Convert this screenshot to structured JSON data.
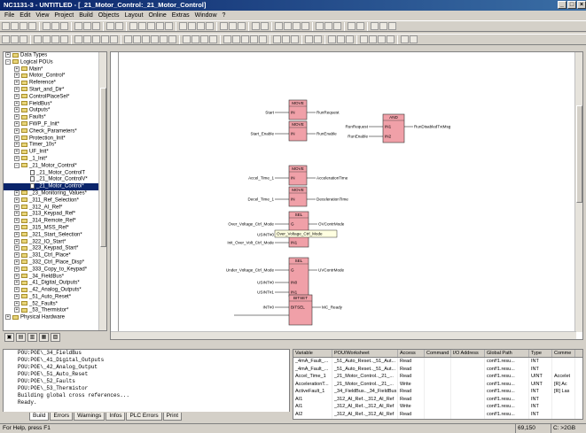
{
  "window": {
    "title": "NC1131-3 - UNTITLED - [_21_Motor_Control:_21_Motor_Control]"
  },
  "menu": [
    "File",
    "Edit",
    "View",
    "Project",
    "Build",
    "Objects",
    "Layout",
    "Online",
    "Extras",
    "Window",
    "?"
  ],
  "tree": [
    {
      "label": "Data Types",
      "level": 1,
      "kind": "folder",
      "toggle": "+"
    },
    {
      "label": "Logical POUs",
      "level": 1,
      "kind": "folder",
      "toggle": "−"
    },
    {
      "label": "Main*",
      "level": 2,
      "kind": "folder",
      "toggle": "+"
    },
    {
      "label": "Motor_Control*",
      "level": 2,
      "kind": "folder",
      "toggle": "+"
    },
    {
      "label": "Reference*",
      "level": 2,
      "kind": "folder",
      "toggle": "+"
    },
    {
      "label": "Start_and_Dir*",
      "level": 2,
      "kind": "folder",
      "toggle": "+"
    },
    {
      "label": "ControlPlaceSel*",
      "level": 2,
      "kind": "folder",
      "toggle": "+"
    },
    {
      "label": "FieldBus*",
      "level": 2,
      "kind": "folder",
      "toggle": "+"
    },
    {
      "label": "Outputs*",
      "level": 2,
      "kind": "folder",
      "toggle": "+"
    },
    {
      "label": "Faults*",
      "level": 2,
      "kind": "folder",
      "toggle": "+"
    },
    {
      "label": "FWP_F_Init*",
      "level": 2,
      "kind": "folder",
      "toggle": "+"
    },
    {
      "label": "Check_Parameters*",
      "level": 2,
      "kind": "folder",
      "toggle": "+"
    },
    {
      "label": "Protection_Init*",
      "level": 2,
      "kind": "folder",
      "toggle": "+"
    },
    {
      "label": "Timer_10s*",
      "level": 2,
      "kind": "folder",
      "toggle": "+"
    },
    {
      "label": "UF_Init*",
      "level": 2,
      "kind": "folder",
      "toggle": "+"
    },
    {
      "label": "_1_Init*",
      "level": 2,
      "kind": "folder",
      "toggle": "+"
    },
    {
      "label": "_21_Motor_Control*",
      "level": 2,
      "kind": "folder",
      "toggle": "−"
    },
    {
      "label": "_21_Motor_ControlT",
      "level": 3,
      "kind": "page",
      "toggle": ""
    },
    {
      "label": "_21_Motor_ControlV*",
      "level": 3,
      "kind": "page",
      "toggle": ""
    },
    {
      "label": "_21_Motor_Control*",
      "level": 3,
      "kind": "page",
      "toggle": ""
    },
    {
      "label": "_23_Monitoring_Values*",
      "level": 2,
      "kind": "folder",
      "toggle": "+"
    },
    {
      "label": "_311_Ref_Selection*",
      "level": 2,
      "kind": "folder",
      "toggle": "+"
    },
    {
      "label": "_312_AI_Ref*",
      "level": 2,
      "kind": "folder",
      "toggle": "+"
    },
    {
      "label": "_313_Keypad_Ref*",
      "level": 2,
      "kind": "folder",
      "toggle": "+"
    },
    {
      "label": "_314_Remote_Ref*",
      "level": 2,
      "kind": "folder",
      "toggle": "+"
    },
    {
      "label": "_315_MSS_Ref*",
      "level": 2,
      "kind": "folder",
      "toggle": "+"
    },
    {
      "label": "_321_Start_Selection*",
      "level": 2,
      "kind": "folder",
      "toggle": "+"
    },
    {
      "label": "_322_IO_Start*",
      "level": 2,
      "kind": "folder",
      "toggle": "+"
    },
    {
      "label": "_323_Keypad_Start*",
      "level": 2,
      "kind": "folder",
      "toggle": "+"
    },
    {
      "label": "_331_Ctrl_Place*",
      "level": 2,
      "kind": "folder",
      "toggle": "+"
    },
    {
      "label": "_332_Ctrl_Place_Disp*",
      "level": 2,
      "kind": "folder",
      "toggle": "+"
    },
    {
      "label": "_333_Copy_to_Keypad*",
      "level": 2,
      "kind": "folder",
      "toggle": "+"
    },
    {
      "label": "_34_FieldBus*",
      "level": 2,
      "kind": "folder",
      "toggle": "+"
    },
    {
      "label": "_41_Digital_Outputs*",
      "level": 2,
      "kind": "folder",
      "toggle": "+"
    },
    {
      "label": "_42_Analog_Outputs*",
      "level": 2,
      "kind": "folder",
      "toggle": "+"
    },
    {
      "label": "_51_Auto_Reset*",
      "level": 2,
      "kind": "folder",
      "toggle": "+"
    },
    {
      "label": "_52_Faults*",
      "level": 2,
      "kind": "folder",
      "toggle": "+"
    },
    {
      "label": "_53_Thermistor*",
      "level": 2,
      "kind": "folder",
      "toggle": "+"
    },
    {
      "label": "Physical Hardware",
      "level": 1,
      "kind": "folder",
      "toggle": "+"
    }
  ],
  "diagram": {
    "blocks": [
      {
        "name": "MOVE",
        "pin1": "IN",
        "in1": "Start",
        "out": "RunRequest"
      },
      {
        "name": "MOVE",
        "pin1": "IN",
        "in1": "Start_Enable",
        "out": "RunEnable"
      },
      {
        "name": "AND",
        "pin1": "IN1",
        "pin2": "IN2",
        "in1": "RunRequest",
        "in2": "RunEnable",
        "out": "RunDisabledTxtMsg"
      },
      {
        "name": "MOVE",
        "pin1": "IN",
        "in1": "Accel_Time_1",
        "out": "AccelerationTime"
      },
      {
        "name": "MOVE",
        "pin1": "IN",
        "in1": "Decel_Time_1",
        "out": "DecelerationTime"
      },
      {
        "name": "SEL",
        "pin1": "G",
        "pin2": "IN0",
        "pin3": "IN1",
        "in1": "Over_Voltage_Ctrl_Mode",
        "in2": "USINT#0",
        "in3": "Init_Over_Volt_Ctrl_Mode",
        "out": "OVContrMode"
      },
      {
        "name": "SEL",
        "pin1": "G",
        "pin2": "IN0",
        "pin3": "IN1",
        "in1": "Under_Voltage_Ctrl_Mode",
        "in2": "USINT#0",
        "in3": "USINT#1",
        "out": "UVContrMode"
      },
      {
        "name": "BITSET",
        "pin1": "BITSEL",
        "in1": "INT#0",
        "in2": "MCStatus",
        "out": "MC_Ready"
      }
    ],
    "tooltip": "Over_Voltage_Ctrl_Mode"
  },
  "messages": [
    "POU:POE\\_34_FieldBus",
    "POU:POE\\_41_Digital_Outputs",
    "POU:POE\\_42_Analog_Output",
    "POU:POE\\_51_Auto_Reset",
    "POU:POE\\_52_Faults",
    "POU:POE\\_53_Thermistor",
    "Building global cross references...",
    "Ready."
  ],
  "msg_tabs": [
    "Build",
    "Errors",
    "Warnings",
    "Infos",
    "PLC Errors",
    "Print"
  ],
  "xref": {
    "headers": [
      "Variable",
      "POU/Worksheet",
      "Access",
      "Command",
      "I/O Address",
      "Global Path",
      "Type",
      "Comme"
    ],
    "rows": [
      [
        "_4mA_Fault_...",
        "_51_Auto_Reset.._51_Aut...",
        "Read",
        "",
        "",
        "conf!1.resu...",
        "INT",
        ""
      ],
      [
        "_4mA_Fault_...",
        "_51_Auto_Reset.._51_Aut...",
        "Read",
        "",
        "",
        "conf!1.resu...",
        "INT",
        ""
      ],
      [
        "Accel_Time_1",
        "_21_Motor_Control.._21_...",
        "Read",
        "",
        "",
        "conf!1.resu...",
        "UINT",
        "Accelet"
      ],
      [
        "AccelerationT...",
        "_21_Motor_Control.._21_...",
        "Write",
        "",
        "",
        "conf!1.resu...",
        "UINT",
        "[R] Ac"
      ],
      [
        "ActiveFault_1",
        "_34_FieldBus.._34_FieldBus",
        "Read",
        "",
        "",
        "conf!1.resu...",
        "INT",
        "[R] Las"
      ],
      [
        "AI1",
        "_312_AI_Ref.._312_AI_Ref",
        "Read",
        "",
        "",
        "conf!1.resu...",
        "INT",
        ""
      ],
      [
        "AI1",
        "_312_AI_Ref.._312_AI_Ref",
        "Write",
        "",
        "",
        "conf!1.resu...",
        "INT",
        ""
      ],
      [
        "AI2",
        "_312_AI_Ref.._312_AI_Ref",
        "Read",
        "",
        "",
        "conf!1.resu...",
        "INT",
        ""
      ],
      [
        "AI2",
        "_312_AI_Ref.._312_AI_Ref",
        "Write",
        "",
        "",
        "conf!1.resu...",
        "INT",
        ""
      ]
    ]
  },
  "status": {
    "message": "For Help, press F1",
    "coords": "69,150",
    "mode": "C: >2GB"
  }
}
